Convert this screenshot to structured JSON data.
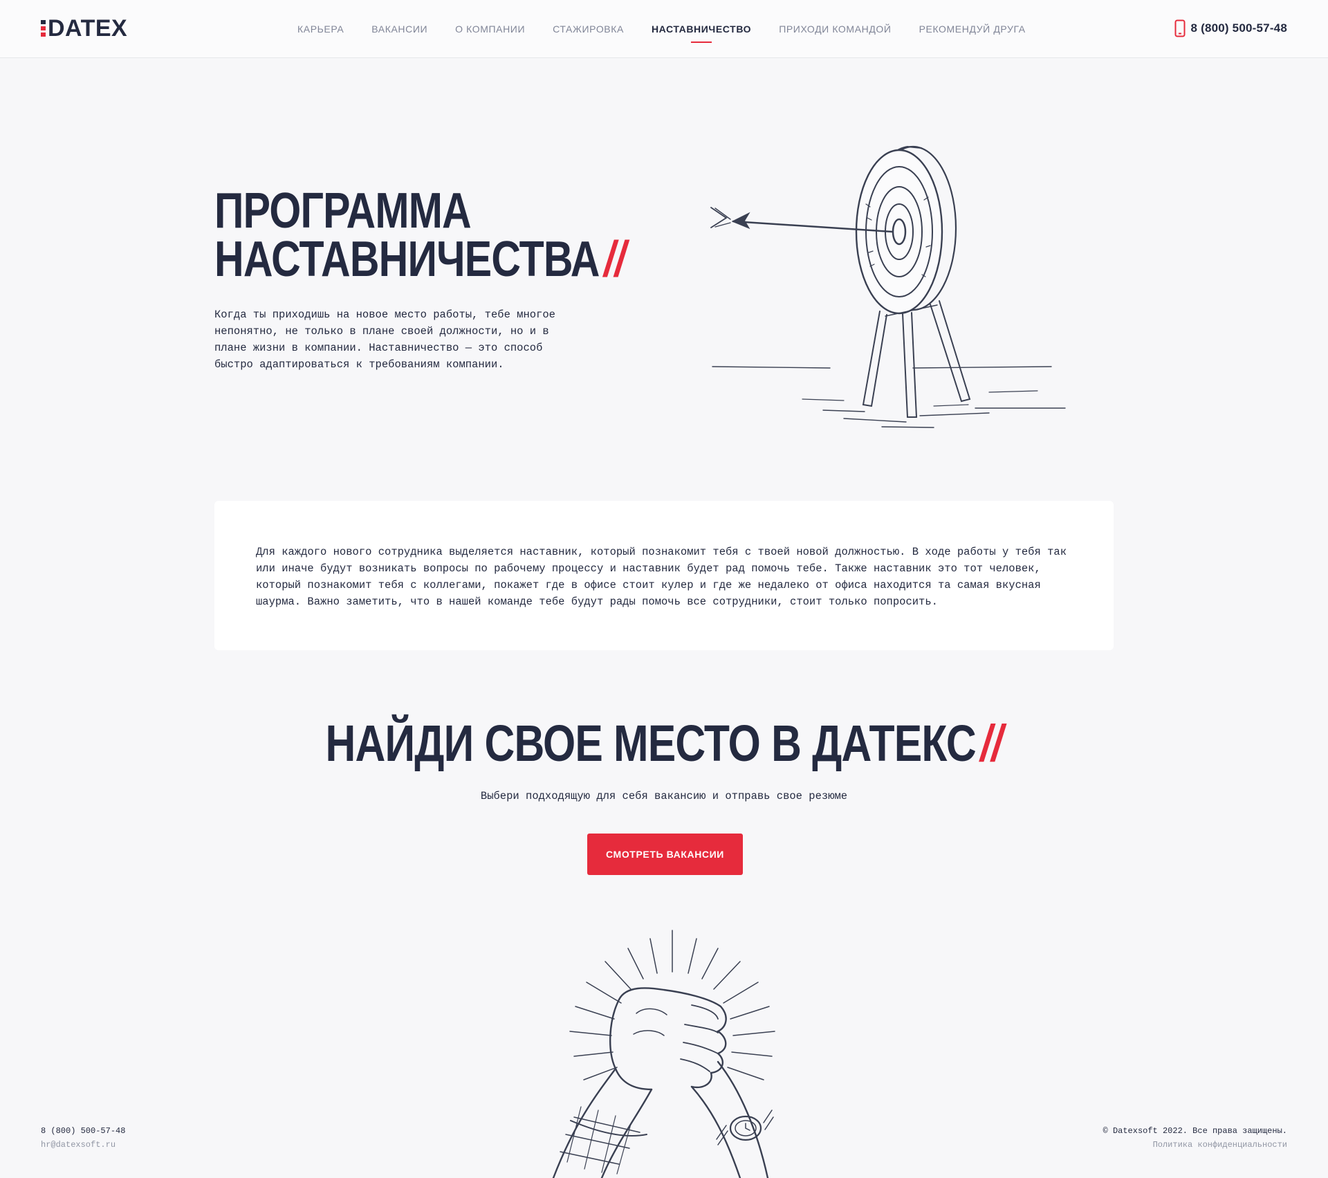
{
  "header": {
    "logo_text": "DATEX",
    "nav": [
      {
        "label": "КАРЬЕРА"
      },
      {
        "label": "ВАКАНСИИ"
      },
      {
        "label": "О КОМПАНИИ"
      },
      {
        "label": "СТАЖИРОВКА"
      },
      {
        "label": "НАСТАВНИЧЕСТВО",
        "active": true
      },
      {
        "label": "ПРИХОДИ КОМАНДОЙ"
      },
      {
        "label": "РЕКОМЕНДУЙ ДРУГА"
      }
    ],
    "phone": "8 (800) 500-57-48",
    "phone_icon": "mobile-phone-icon"
  },
  "hero": {
    "title_line1": "ПРОГРАММА",
    "title_line2": "НАСТАВНИЧЕСТВА",
    "slashes": "//",
    "text": "Когда ты приходишь на новое место работы, тебе многое непонятно, не только в плане своей должности, но и в плане жизни в компании. Наставничество — это способ быстро адаптироваться к требованиям компании.",
    "illustration": "archery-target-with-arrow"
  },
  "card": {
    "text": "Для каждого нового сотрудника выделяется наставник, который познакомит тебя с твоей новой должностью. В ходе работы у тебя так или иначе будут возникать вопросы по рабочему процессу и наставник будет рад помочь тебе. Также наставник это тот человек, который познакомит тебя с коллегами, покажет где в офисе стоит кулер и где же недалеко от офиса находится та самая вкусная шаурма. Важно заметить, что в нашей команде тебе будут рады помочь все сотрудники, стоит только попросить."
  },
  "cta": {
    "title": "НАЙДИ СВОЕ МЕСТО В ДАТЕКС",
    "slashes": "//",
    "subtitle": "Выбери подходящую для себя вакансию и отправь свое резюме",
    "button_label": "СМОТРЕТЬ ВАКАНСИИ",
    "illustration": "handshake"
  },
  "footer": {
    "phone": "8 (800) 500-57-48",
    "email": "hr@datexsoft.ru",
    "copyright": "© Datexsoft 2022. Все права защищены.",
    "privacy": "Политика конфиденциальности"
  },
  "colors": {
    "accent": "#e62b3c",
    "text": "#242a40",
    "background": "#f7f7f9",
    "muted": "#808597"
  }
}
